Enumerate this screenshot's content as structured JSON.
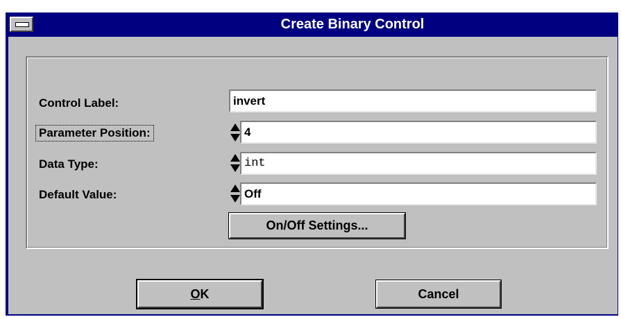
{
  "window": {
    "title": "Create Binary Control"
  },
  "form": {
    "control_label": {
      "label": "Control Label:",
      "value": "invert"
    },
    "parameter_position": {
      "label": "Parameter Position:",
      "value": "4"
    },
    "data_type": {
      "label": "Data Type:",
      "value": "int"
    },
    "default_value": {
      "label": "Default Value:",
      "value": "Off"
    },
    "onoff_button": "On/Off Settings..."
  },
  "buttons": {
    "ok_mnemonic": "O",
    "ok_rest": "K",
    "cancel": "Cancel"
  },
  "colors": {
    "titlebar": "#000080",
    "face": "#c0c0c0"
  }
}
